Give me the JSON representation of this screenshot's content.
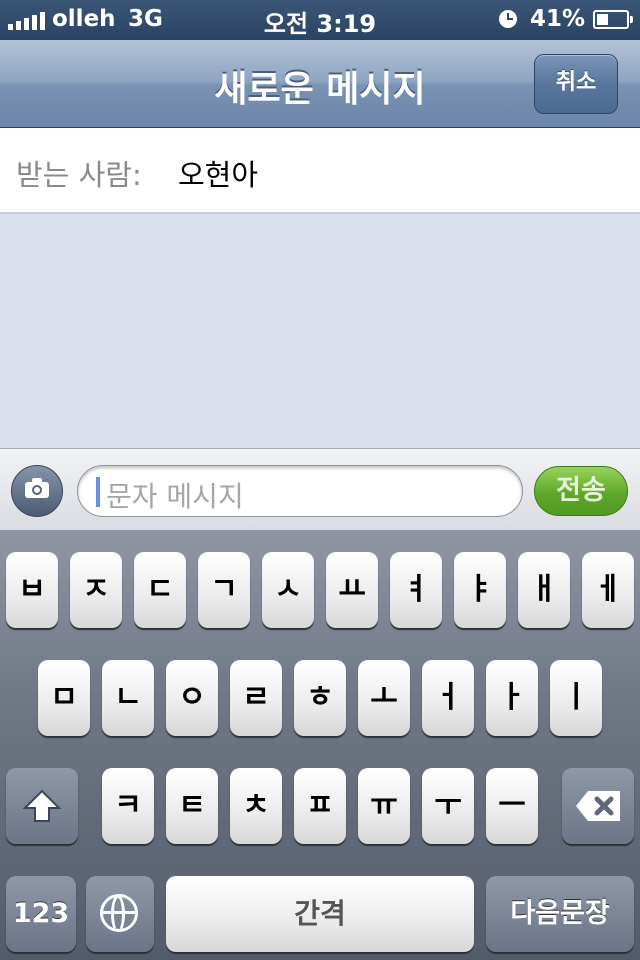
{
  "status_bar": {
    "carrier": "olleh",
    "network": "3G",
    "time": "오전 3:19",
    "battery_percent": "41%",
    "battery_level": 0.41,
    "icons": [
      "signal-bars-icon",
      "alarm-clock-icon",
      "battery-icon"
    ]
  },
  "nav": {
    "title": "새로운 메시지",
    "cancel_label": "취소"
  },
  "recipient": {
    "label": "받는 사람:",
    "name": "오현아"
  },
  "compose": {
    "placeholder": "문자 메시지",
    "send_label": "전송",
    "camera_icon": "camera-icon"
  },
  "keyboard": {
    "row1": [
      "ㅂ",
      "ㅈ",
      "ㄷ",
      "ㄱ",
      "ㅅ",
      "ㅛ",
      "ㅕ",
      "ㅑ",
      "ㅐ",
      "ㅔ"
    ],
    "row2": [
      "ㅁ",
      "ㄴ",
      "ㅇ",
      "ㄹ",
      "ㅎ",
      "ㅗ",
      "ㅓ",
      "ㅏ",
      "ㅣ"
    ],
    "row3": [
      "ㅋ",
      "ㅌ",
      "ㅊ",
      "ㅍ",
      "ㅠ",
      "ㅜ",
      "ㅡ"
    ],
    "numbers_label": "123",
    "space_label": "간격",
    "return_label": "다음문장",
    "shift_icon": "shift-arrow-icon",
    "delete_icon": "backspace-icon",
    "globe_icon": "globe-icon"
  },
  "colors": {
    "nav_bar": "#7a92b3",
    "send_button": "#5fa82b",
    "background": "#dbe1ec"
  }
}
